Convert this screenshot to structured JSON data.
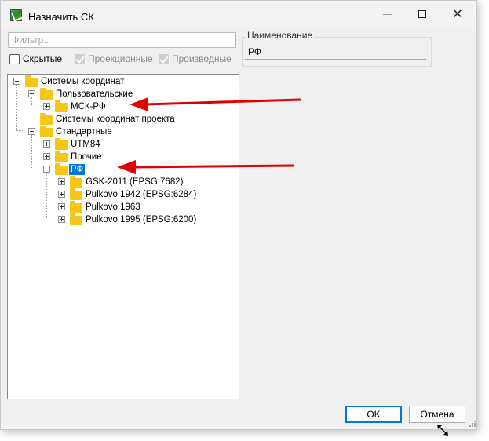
{
  "window": {
    "title": "Назначить СК",
    "icon": "app-icon",
    "controls": {
      "minimize": "minimize-icon",
      "maximize": "maximize-icon",
      "close": "close-icon"
    }
  },
  "filter": {
    "placeholder": "Фильтр..",
    "value": ""
  },
  "options": {
    "hidden": {
      "label": "Скрытые",
      "checked": false,
      "enabled": true
    },
    "projected": {
      "label": "Проекционные",
      "checked": true,
      "enabled": false
    },
    "derived": {
      "label": "Производные",
      "checked": true,
      "enabled": false
    }
  },
  "details": {
    "group_title": "Наименование",
    "name_value": "РФ"
  },
  "tree": {
    "root": "Системы координат",
    "user": "Пользовательские",
    "msk": "МСК-РФ",
    "project": "Системы координат проекта",
    "standard": "Стандартные",
    "utm": "UTM84",
    "other": "Прочие",
    "rf": "РФ",
    "gsk": "GSK-2011 (EPSG:7682)",
    "p1942": "Pulkovo 1942 (EPSG:6284)",
    "p1963": "Pulkovo 1963",
    "p1995": "Pulkovo 1995 (EPSG:6200)"
  },
  "buttons": {
    "ok": "OK",
    "cancel": "Отмена"
  },
  "colors": {
    "accent": "#0078d7",
    "folder": "#f7c614",
    "annotation_arrow": "#e00000"
  }
}
